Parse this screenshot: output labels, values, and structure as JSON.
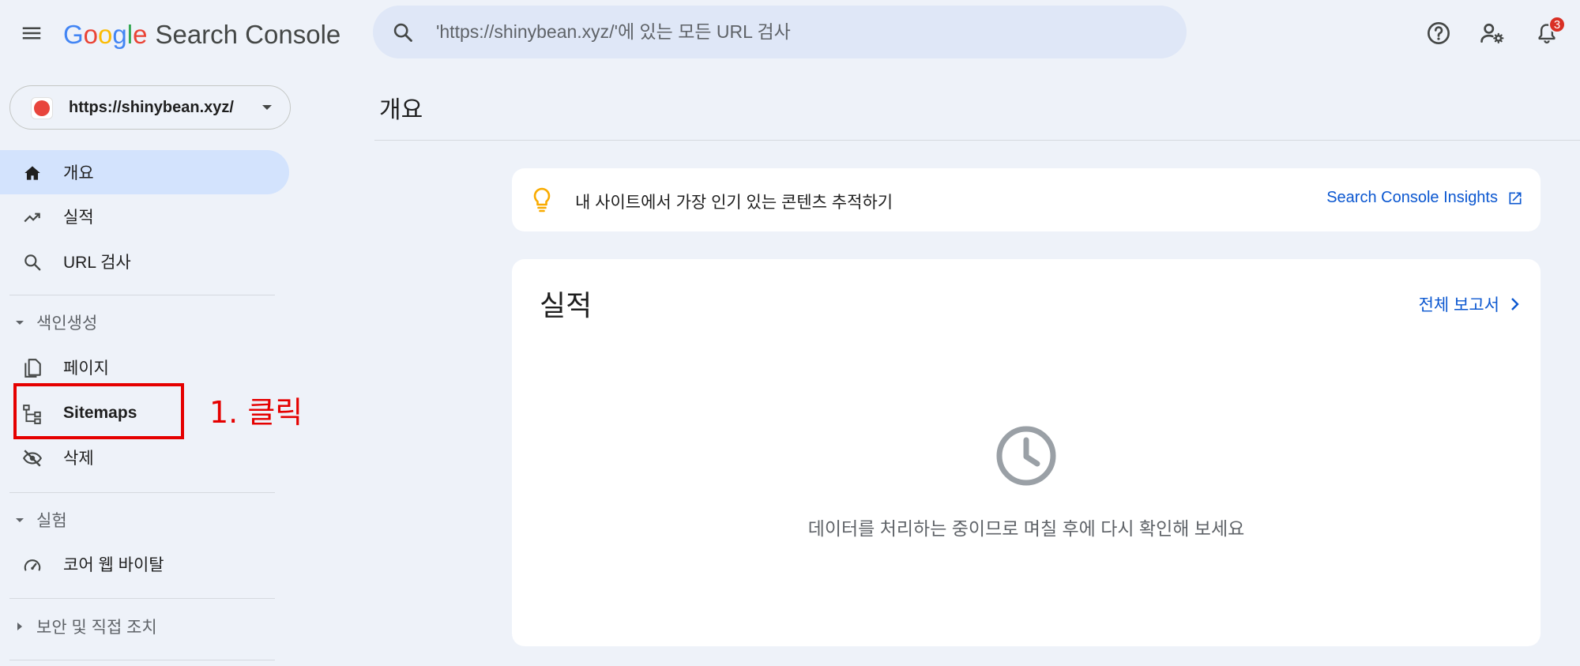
{
  "header": {
    "logo": {
      "g1": "G",
      "g2": "o",
      "g3": "o",
      "g4": "g",
      "g5": "l",
      "g6": "e",
      "product": "Search Console"
    },
    "search": {
      "placeholder": "'https://shinybean.xyz/'에 있는 모든 URL 검사",
      "value": ""
    },
    "notifications_count": "3",
    "icons": [
      "menu-icon",
      "search-icon",
      "help-icon",
      "manage-users-icon",
      "bell-icon"
    ]
  },
  "sidebar": {
    "property": {
      "url": "https://shinybean.xyz/"
    },
    "items": [
      {
        "label": "개요",
        "icon": "home-icon",
        "active": true
      },
      {
        "label": "실적",
        "icon": "trending-up-icon"
      },
      {
        "label": "URL 검사",
        "icon": "search-icon"
      }
    ],
    "sections": [
      {
        "label": "색인생성",
        "expanded": true,
        "items": [
          {
            "label": "페이지",
            "icon": "pages-icon"
          },
          {
            "label": "Sitemaps",
            "icon": "sitemap-icon"
          },
          {
            "label": "삭제",
            "icon": "eye-off-icon"
          }
        ]
      },
      {
        "label": "실험",
        "expanded": true,
        "items": [
          {
            "label": "코어 웹 바이탈",
            "icon": "speed-icon"
          }
        ]
      },
      {
        "label": "보안 및 직접 조치",
        "expanded": false,
        "items": []
      }
    ]
  },
  "annotation": {
    "text": "1. 클릭",
    "color": "#e50000"
  },
  "main": {
    "title": "개요",
    "insights": {
      "text": "내 사이트에서 가장 인기 있는 콘텐츠 추적하기",
      "link": "Search Console Insights"
    },
    "performance": {
      "title": "실적",
      "full_report": "전체 보고서",
      "message": "데이터를 처리하는 중이므로 며칠 후에 다시 확인해 보세요"
    }
  },
  "colors": {
    "accent": "#0b57d0",
    "active_bg": "#d3e3fd",
    "page_bg": "#eef2f9",
    "badge": "#d93025"
  }
}
